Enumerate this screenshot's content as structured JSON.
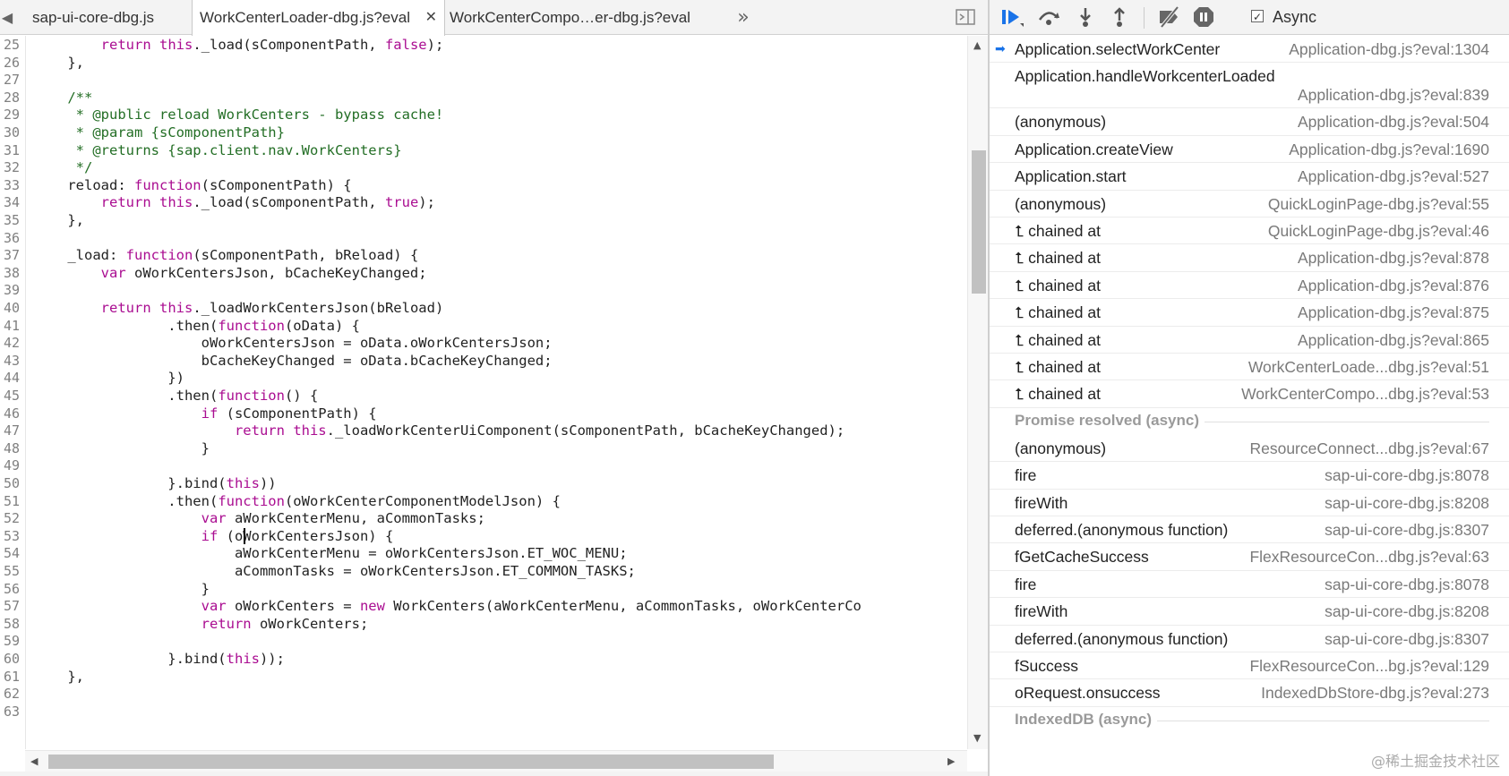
{
  "editor": {
    "tabs": [
      {
        "label": "sap-ui-core-dbg.js",
        "active": false
      },
      {
        "label": "WorkCenterLoader-dbg.js?eval",
        "active": true
      },
      {
        "label": "WorkCenterCompo…er-dbg.js?eval",
        "active": false
      }
    ],
    "overflow_label": "»",
    "code_lines": [
      {
        "n": "25",
        "t": "        return this._load(sComponentPath, false);"
      },
      {
        "n": "26",
        "t": "    },"
      },
      {
        "n": "27",
        "t": ""
      },
      {
        "n": "28",
        "t": "    /**"
      },
      {
        "n": "29",
        "t": "     * @public reload WorkCenters - bypass cache!"
      },
      {
        "n": "30",
        "t": "     * @param {sComponentPath}"
      },
      {
        "n": "31",
        "t": "     * @returns {sap.client.nav.WorkCenters}"
      },
      {
        "n": "32",
        "t": "     */"
      },
      {
        "n": "33",
        "t": "    reload: function(sComponentPath) {"
      },
      {
        "n": "34",
        "t": "        return this._load(sComponentPath, true);"
      },
      {
        "n": "35",
        "t": "    },"
      },
      {
        "n": "36",
        "t": ""
      },
      {
        "n": "37",
        "t": "    _load: function(sComponentPath, bReload) {"
      },
      {
        "n": "38",
        "t": "        var oWorkCentersJson, bCacheKeyChanged;"
      },
      {
        "n": "39",
        "t": ""
      },
      {
        "n": "40",
        "t": "        return this._loadWorkCentersJson(bReload)"
      },
      {
        "n": "41",
        "t": "                .then(function(oData) {"
      },
      {
        "n": "42",
        "t": "                    oWorkCentersJson = oData.oWorkCentersJson;"
      },
      {
        "n": "43",
        "t": "                    bCacheKeyChanged = oData.bCacheKeyChanged;"
      },
      {
        "n": "44",
        "t": "                })"
      },
      {
        "n": "45",
        "t": "                .then(function() {"
      },
      {
        "n": "46",
        "t": "                    if (sComponentPath) {"
      },
      {
        "n": "47",
        "t": "                        return this._loadWorkCenterUiComponent(sComponentPath, bCacheKeyChanged);"
      },
      {
        "n": "48",
        "t": "                    }"
      },
      {
        "n": "49",
        "t": ""
      },
      {
        "n": "50",
        "t": "                }.bind(this))"
      },
      {
        "n": "51",
        "t": "                .then(function(oWorkCenterComponentModelJson) {"
      },
      {
        "n": "52",
        "t": "                    var aWorkCenterMenu, aCommonTasks;"
      },
      {
        "n": "53",
        "t": "                    if (oWorkCentersJson) {"
      },
      {
        "n": "54",
        "t": "                        aWorkCenterMenu = oWorkCentersJson.ET_WOC_MENU;"
      },
      {
        "n": "55",
        "t": "                        aCommonTasks = oWorkCentersJson.ET_COMMON_TASKS;"
      },
      {
        "n": "56",
        "t": "                    }"
      },
      {
        "n": "57",
        "t": "                    var oWorkCenters = new WorkCenters(aWorkCenterMenu, aCommonTasks, oWorkCenterCo"
      },
      {
        "n": "58",
        "t": "                    return oWorkCenters;"
      },
      {
        "n": "59",
        "t": ""
      },
      {
        "n": "60",
        "t": "                }.bind(this));"
      },
      {
        "n": "61",
        "t": "    },"
      },
      {
        "n": "62",
        "t": ""
      },
      {
        "n": "63",
        "t": ""
      }
    ]
  },
  "debugger": {
    "async_label": "Async",
    "async_checked": true,
    "frames": [
      {
        "kind": "frame",
        "name": "Application.selectWorkCenter",
        "loc": "Application-dbg.js?eval:1304",
        "current": true
      },
      {
        "kind": "frame2",
        "name": "Application.handleWorkcenterLoaded",
        "loc": "Application-dbg.js?eval:839"
      },
      {
        "kind": "frame",
        "name": "(anonymous)",
        "loc": "Application-dbg.js?eval:504"
      },
      {
        "kind": "frame",
        "name": "Application.createView",
        "loc": "Application-dbg.js?eval:1690"
      },
      {
        "kind": "frame",
        "name": "Application.start",
        "loc": "Application-dbg.js?eval:527"
      },
      {
        "kind": "frame",
        "name": "(anonymous)",
        "loc": "QuickLoginPage-dbg.js?eval:55"
      },
      {
        "kind": "frame",
        "name": "⮤ chained at",
        "loc": "QuickLoginPage-dbg.js?eval:46"
      },
      {
        "kind": "frame",
        "name": "⮤ chained at",
        "loc": "Application-dbg.js?eval:878"
      },
      {
        "kind": "frame",
        "name": "⮤ chained at",
        "loc": "Application-dbg.js?eval:876"
      },
      {
        "kind": "frame",
        "name": "⮤ chained at",
        "loc": "Application-dbg.js?eval:875"
      },
      {
        "kind": "frame",
        "name": "⮤ chained at",
        "loc": "Application-dbg.js?eval:865"
      },
      {
        "kind": "frame",
        "name": "⮤ chained at",
        "loc": "WorkCenterLoade...dbg.js?eval:51"
      },
      {
        "kind": "frame",
        "name": "⮤ chained at",
        "loc": "WorkCenterCompo...dbg.js?eval:53"
      },
      {
        "kind": "sep",
        "name": "Promise resolved (async)"
      },
      {
        "kind": "frame",
        "name": "(anonymous)",
        "loc": "ResourceConnect...dbg.js?eval:67"
      },
      {
        "kind": "frame",
        "name": "fire",
        "loc": "sap-ui-core-dbg.js:8078"
      },
      {
        "kind": "frame",
        "name": "fireWith",
        "loc": "sap-ui-core-dbg.js:8208"
      },
      {
        "kind": "frame",
        "name": "deferred.(anonymous function)",
        "loc": "sap-ui-core-dbg.js:8307"
      },
      {
        "kind": "frame",
        "name": "fGetCacheSuccess",
        "loc": "FlexResourceCon...dbg.js?eval:63"
      },
      {
        "kind": "frame",
        "name": "fire",
        "loc": "sap-ui-core-dbg.js:8078"
      },
      {
        "kind": "frame",
        "name": "fireWith",
        "loc": "sap-ui-core-dbg.js:8208"
      },
      {
        "kind": "frame",
        "name": "deferred.(anonymous function)",
        "loc": "sap-ui-core-dbg.js:8307"
      },
      {
        "kind": "frame",
        "name": "fSuccess",
        "loc": "FlexResourceCon...bg.js?eval:129"
      },
      {
        "kind": "frame",
        "name": "oRequest.onsuccess",
        "loc": "IndexedDbStore-dbg.js?eval:273"
      },
      {
        "kind": "sep",
        "name": "IndexedDB (async)"
      }
    ]
  },
  "watermark": "@稀土掘金技术社区",
  "colors": {
    "keyword": "#aa0d91",
    "comment": "#236e25",
    "accent": "#1a73e8"
  }
}
